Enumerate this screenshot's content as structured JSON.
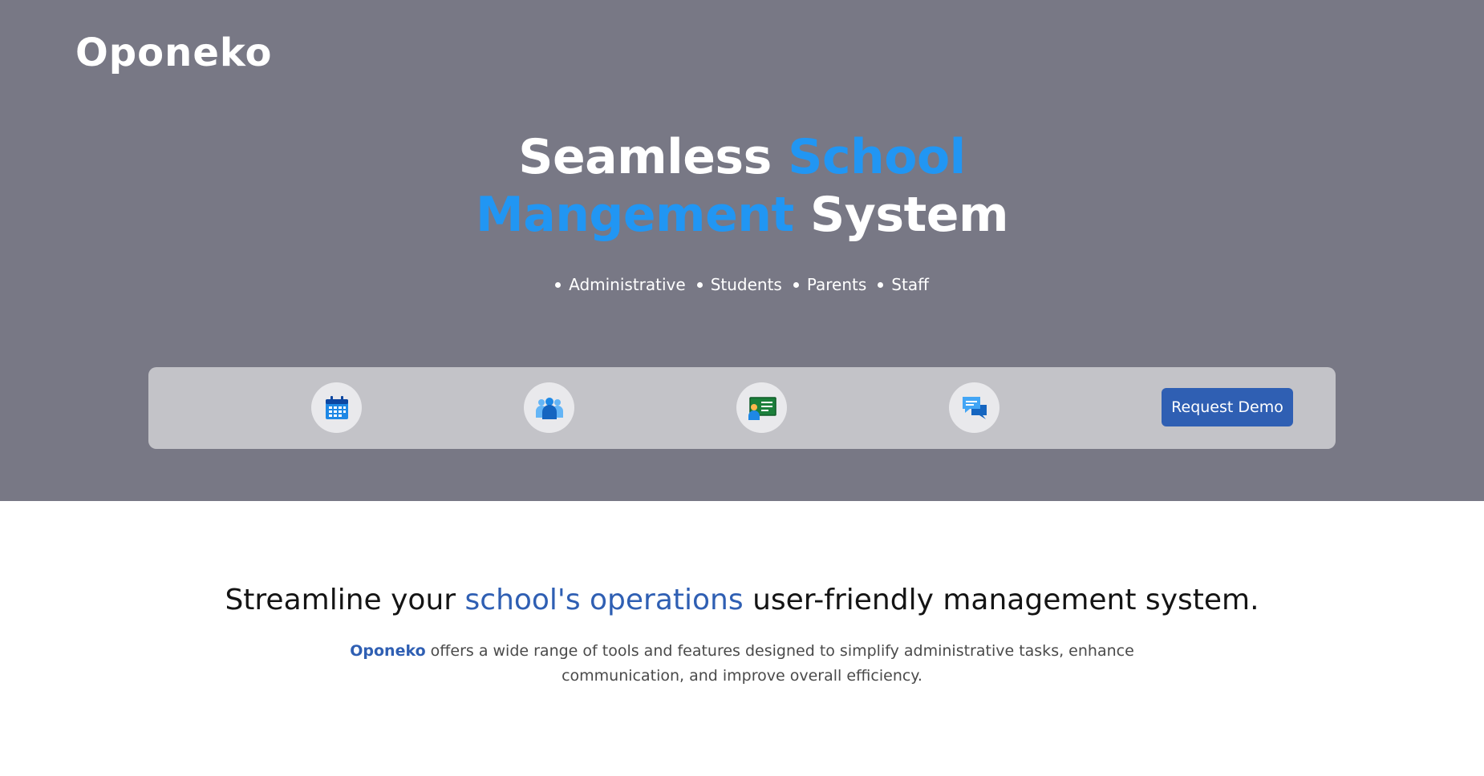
{
  "brand": {
    "logo_text": "Oponeko"
  },
  "hero": {
    "headline_part1": "Seamless ",
    "headline_accent1": "School",
    "headline_accent2": "Mangement",
    "headline_part2": " System",
    "audience": [
      "Administrative",
      "Students",
      "Parents",
      "Staff"
    ],
    "accent_color": "#2196f3",
    "background_color": "#787885"
  },
  "feature_bar": {
    "icons": [
      "calendar-icon",
      "users-group-icon",
      "teacher-board-icon",
      "chat-bubbles-icon"
    ],
    "demo_button_label": "Request Demo",
    "button_color": "#2f5fb3"
  },
  "intro": {
    "title_part1": "Streamline your ",
    "title_accent": "school's operations",
    "title_part2": " user-friendly management system.",
    "desc_brand": "Oponeko",
    "desc_text": " offers a wide range of tools and features designed to simplify administrative tasks, enhance communication, and improve overall efficiency."
  }
}
